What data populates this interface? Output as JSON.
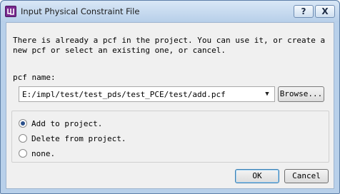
{
  "window": {
    "title": "Input Physical Constraint File",
    "help_label": "?",
    "close_label": "X"
  },
  "dialog": {
    "message": "There is already a pcf in the project. You can use it, or create a new pcf or select an existing one, or cancel.",
    "pcf_label": "pcf name:",
    "pcf_value": "E:/impl/test/test_pds/test_PCE/test/add.pcf",
    "browse_label": "Browse...",
    "options": [
      {
        "label": "Add to project.",
        "checked": true
      },
      {
        "label": "Delete from project.",
        "checked": false
      },
      {
        "label": "none.",
        "checked": false
      }
    ],
    "ok_label": "OK",
    "cancel_label": "Cancel"
  },
  "icons": {
    "app": "app-logo-icon",
    "dropdown": "chevron-down-icon"
  }
}
